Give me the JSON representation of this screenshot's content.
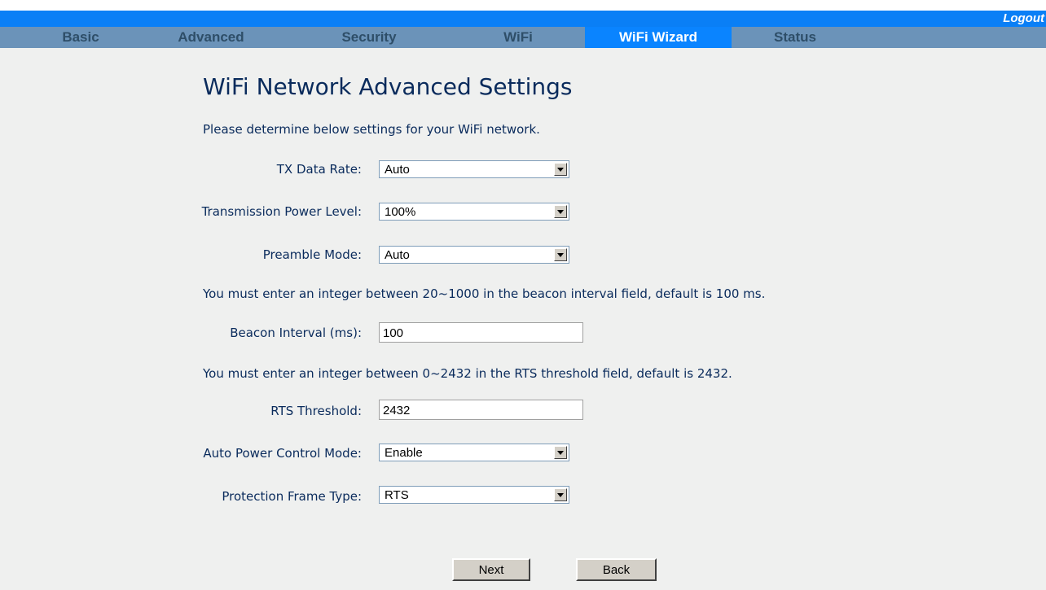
{
  "header": {
    "logout_label": "Logout"
  },
  "nav": {
    "tabs": [
      {
        "label": "Basic"
      },
      {
        "label": "Advanced"
      },
      {
        "label": "Security"
      },
      {
        "label": "WiFi"
      },
      {
        "label": "WiFi Wizard",
        "active": true
      },
      {
        "label": "Status"
      }
    ]
  },
  "main": {
    "title": "WiFi Network Advanced Settings",
    "instruction": "Please determine below settings for your WiFi network.",
    "tx_data_rate": {
      "label": "TX Data Rate:",
      "value": "Auto"
    },
    "transmission_power": {
      "label": "Transmission Power Level:",
      "value": "100%"
    },
    "preamble_mode": {
      "label": "Preamble Mode:",
      "value": "Auto"
    },
    "beacon_note": "You must enter an integer between 20~1000 in the beacon interval field, default is 100 ms.",
    "beacon_interval": {
      "label": "Beacon Interval (ms):",
      "value": "100"
    },
    "rts_note": "You must enter an integer between 0~2432 in the RTS threshold field, default is 2432.",
    "rts_threshold": {
      "label": "RTS Threshold:",
      "value": "2432"
    },
    "auto_power_control": {
      "label": "Auto Power Control Mode:",
      "value": "Enable"
    },
    "protection_frame": {
      "label": "Protection Frame Type:",
      "value": "RTS"
    },
    "next_label": "Next",
    "back_label": "Back"
  },
  "colors": {
    "top_strip": "#0a7ff6",
    "nav_bar": "#6b93b9",
    "active_tab": "#0a84ff",
    "content_bg": "#eff0ef",
    "text": "#0a2b5c"
  }
}
